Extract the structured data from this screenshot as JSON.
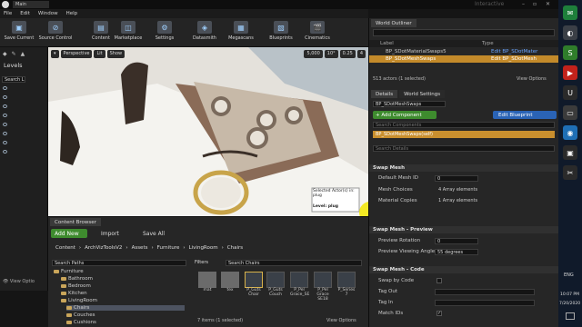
{
  "window": {
    "tab_title": "Main",
    "watermark": "Interactive"
  },
  "menu": [
    "File",
    "Edit",
    "Window",
    "Help"
  ],
  "toolbar": [
    {
      "label": "Save Current",
      "icon": "save-icon"
    },
    {
      "label": "Source Control",
      "icon": "source-control-icon"
    },
    {
      "label": "Content",
      "icon": "content-icon"
    },
    {
      "label": "Marketplace",
      "icon": "marketplace-icon"
    },
    {
      "label": "Settings",
      "icon": "settings-icon"
    },
    {
      "label": "Datasmith",
      "icon": "datasmith-icon"
    },
    {
      "label": "Megascans",
      "icon": "megascans-icon"
    },
    {
      "label": "Blueprints",
      "icon": "blueprints-icon"
    },
    {
      "label": "Cinematics",
      "icon": "cinematics-icon"
    }
  ],
  "modes": {
    "levels_label": "Levels",
    "search_placeholder": "Search L"
  },
  "viewport": {
    "perspective": "Perspective",
    "lit": "Lit",
    "show": "Show",
    "grid_snap": "5,000",
    "angle_snap": "10°",
    "scale_snap": "0.25",
    "camera_speed": "4",
    "tooltip": "Selected Actor(s) in: plug",
    "level_label": "Level: plug"
  },
  "content_browser": {
    "tab": "Content Browser",
    "add_new": "Add New",
    "import": "Import",
    "save_all": "Save All",
    "breadcrumb": [
      "Content",
      "ArchVizToolsV2",
      "Assets",
      "Furniture",
      "LivingRoom",
      "Chairs"
    ],
    "search_paths_placeholder": "Search Paths",
    "filters": "Filters",
    "search_placeholder": "Search Chairs",
    "tree": [
      "Furniture",
      "Bathroom",
      "Bedroom",
      "Kitchen",
      "LivingRoom",
      "Chairs",
      "Couches",
      "Cushions",
      "Decorations"
    ],
    "folders": [
      "mat",
      "tex"
    ],
    "assets": [
      "P_Guts Chair",
      "P_Guts Couch",
      "P_Pel Grace_SE",
      "P_Pel Grace SE18",
      "P_Series 7"
    ],
    "status": "7 items (1 selected)",
    "view_options": "View Options"
  },
  "outliner": {
    "tab": "World Outliner",
    "col_label": "Label",
    "col_type": "Type",
    "rows": [
      {
        "label": "BP_SDotMaterialSwaps5",
        "type": "Edit BP_SDotMater"
      },
      {
        "label": "BP_SDotMeshSwaps",
        "type": "Edit BP_SDotMesh"
      }
    ],
    "status": "513 actors (1 selected)",
    "view_options": "View Options"
  },
  "details": {
    "tab": "Details",
    "tab2": "World Settings",
    "actor_name": "BP_SDotMeshSwaps",
    "add_component": "+ Add Component",
    "edit_blueprint": "Edit Blueprint",
    "search_components": "Search Components",
    "component": "BP_SDotMeshSwaps(self)",
    "search_details": "Search Details",
    "swap_mesh": {
      "title": "Swap Mesh",
      "default_mesh_id_label": "Default Mesh ID",
      "default_mesh_id": "0",
      "mesh_choices_label": "Mesh Choices",
      "mesh_choices": "4 Array elements",
      "material_copies_label": "Material Copies",
      "material_copies": "1 Array elements"
    },
    "preview": {
      "title": "Swap Mesh - Preview",
      "rotation_label": "Preview Rotation",
      "rotation": "0",
      "angle_label": "Preview Viewing Angle",
      "angle": "55 degrees"
    },
    "code": {
      "title": "Swap Mesh - Code",
      "swap_code_label": "Swap by Code",
      "tag_out_label": "Tag Out",
      "tag_in_label": "Tag In",
      "match_ids_label": "Match IDs"
    }
  },
  "taskbar": {
    "lang": "ENG",
    "time": "10:07 PM",
    "date": "7/20/2020"
  }
}
